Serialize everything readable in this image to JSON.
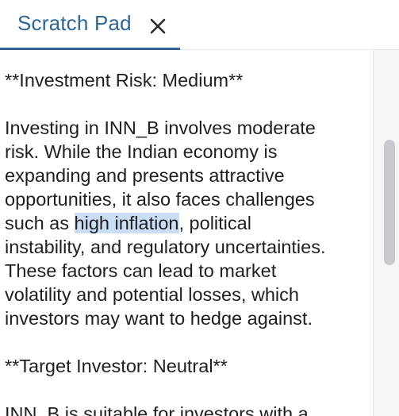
{
  "tab": {
    "label": "Scratch Pad"
  },
  "scratchpad": {
    "heading1": "**Investment Risk: Medium**",
    "para1": {
      "line1": "Investing in INN_B involves moderate",
      "line2": "risk. While the Indian economy is",
      "line3": "expanding and presents attractive",
      "line4": "opportunities, it also faces challenges",
      "line5_before": "such as ",
      "line5_highlight": "high inflation",
      "line5_after": ", political",
      "line6": "instability, and regulatory uncertainties.",
      "line7": "These factors can lead to market",
      "line8": "volatility and potential losses, which",
      "line9": "investors may want to hedge against."
    },
    "heading2": "**Target Investor: Neutral**",
    "para2_line1": "INN_B is suitable for investors with a"
  },
  "colors": {
    "accent": "#2f6595",
    "highlight": "#c9def5",
    "text": "#1f1f1f"
  },
  "icons": {
    "close": "close-icon"
  }
}
